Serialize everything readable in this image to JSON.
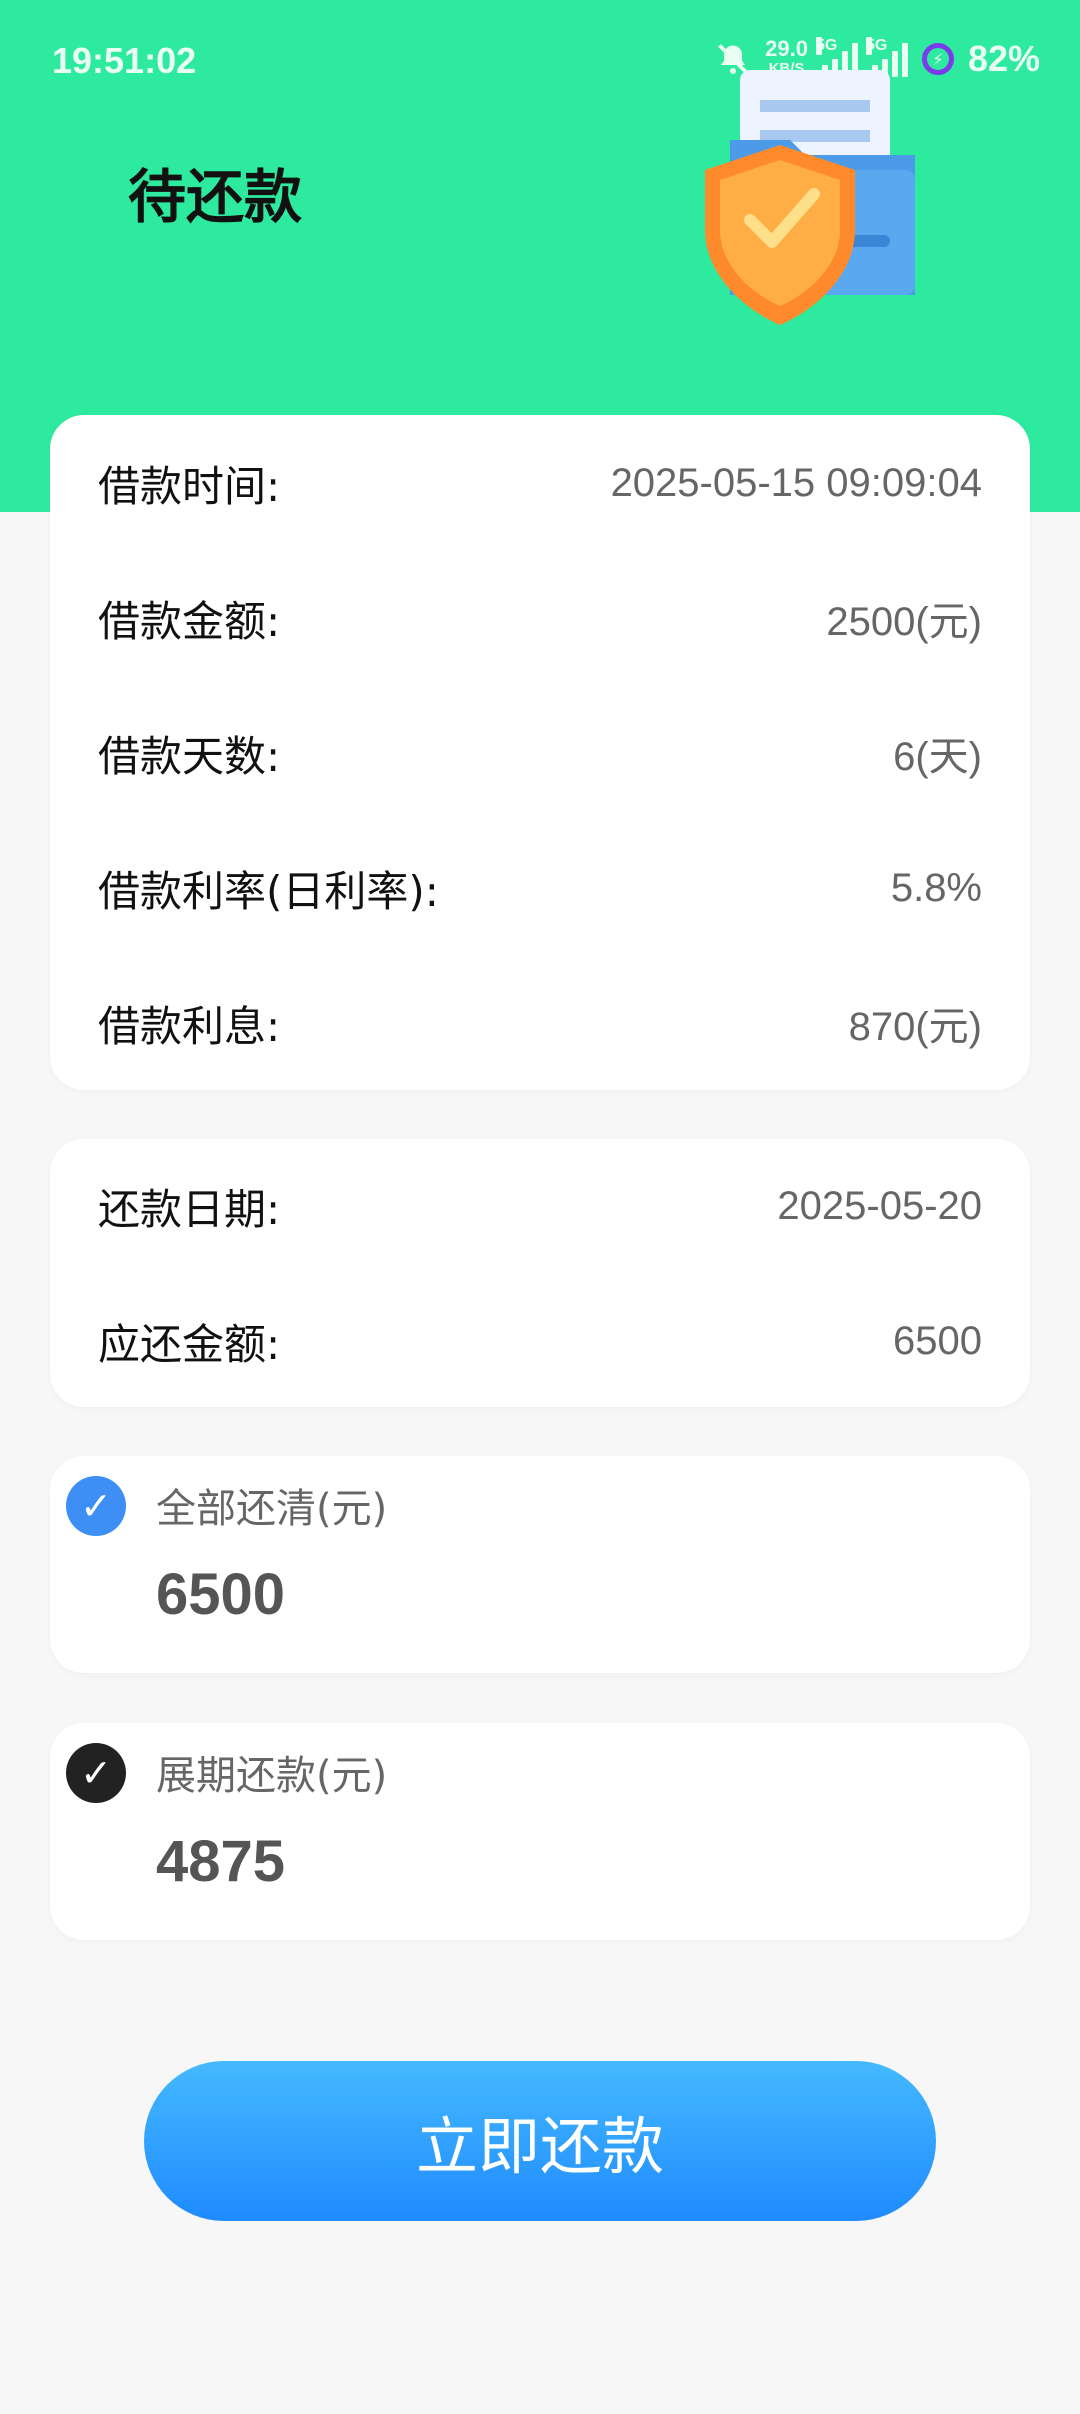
{
  "status_bar": {
    "time": "19:51:02",
    "net_speed": "29.0",
    "net_unit": "KB/S",
    "signal1": "5G",
    "signal2": "5G",
    "battery": "82%"
  },
  "page": {
    "title": "待还款"
  },
  "loan": {
    "rows": [
      {
        "label": "借款时间:",
        "value": "2025-05-15 09:09:04"
      },
      {
        "label": "借款金额:",
        "value": "2500(元)"
      },
      {
        "label": "借款天数:",
        "value": "6(天)"
      },
      {
        "label": "借款利率(日利率):",
        "value": "5.8%"
      },
      {
        "label": "借款利息:",
        "value": "870(元)"
      }
    ]
  },
  "repay": {
    "rows": [
      {
        "label": "还款日期:",
        "value": "2025-05-20"
      },
      {
        "label": "应还金额:",
        "value": "6500"
      }
    ]
  },
  "options": [
    {
      "title": "全部还清(元)",
      "amount": "6500",
      "selected": true
    },
    {
      "title": "展期还款(元)",
      "amount": "4875",
      "selected": false
    }
  ],
  "action": {
    "label": "立即还款"
  },
  "icons": {
    "check": "✓",
    "mute": "bell-off-icon",
    "charging": "bolt"
  },
  "colors": {
    "header": "#2eea9f",
    "selected": "#3d8ff5",
    "unselected": "#222222",
    "button": "#2a95ff"
  }
}
